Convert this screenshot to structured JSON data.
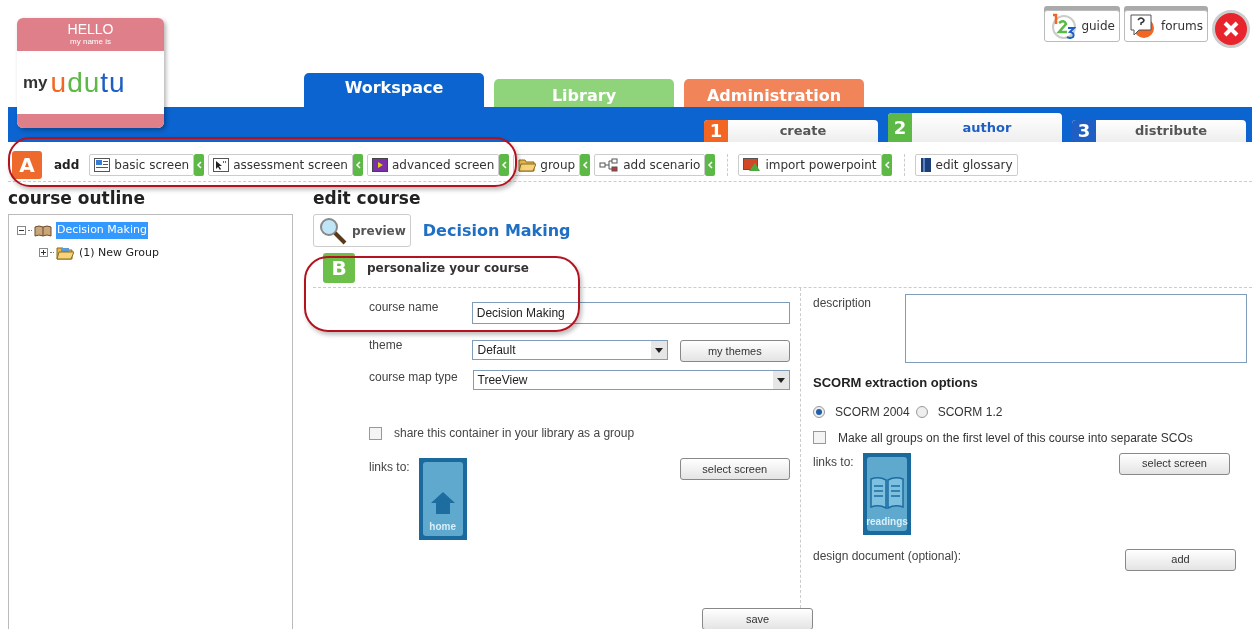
{
  "logo": {
    "badge_title": "HELLO",
    "badge_subtitle": "my name is",
    "prefix": "my",
    "name": "udutu"
  },
  "top_buttons": [
    {
      "kind": "guide",
      "label": "guide"
    },
    {
      "kind": "forums",
      "label": "forums"
    },
    {
      "kind": "close"
    }
  ],
  "main_tabs": [
    {
      "label": "Workspace",
      "selected": true,
      "color": "#0b64cf"
    },
    {
      "label": "Library",
      "selected": false,
      "color": "#8fd47a"
    },
    {
      "label": "Administration",
      "selected": false,
      "color": "#f2845a"
    }
  ],
  "step_tabs": [
    {
      "number": "1",
      "label": "create",
      "selected": false,
      "color": "#f26522"
    },
    {
      "number": "2",
      "label": "author",
      "selected": true,
      "color": "#5cb946"
    },
    {
      "number": "3",
      "label": "distribute",
      "selected": false,
      "color": "#1f5fc4"
    }
  ],
  "toolbar": {
    "badge": "A",
    "label": "add",
    "groups": [
      [
        {
          "label": "basic screen",
          "has_menu": true
        },
        {
          "label": "assessment screen",
          "has_menu": true
        },
        {
          "label": "advanced screen",
          "has_menu": true
        },
        {
          "label": "group",
          "has_menu": true
        },
        {
          "label": "add scenario",
          "has_menu": true
        }
      ],
      [
        {
          "label": "import powerpoint",
          "has_menu": true
        }
      ],
      [
        {
          "label": "edit glossary",
          "has_menu": false
        }
      ]
    ]
  },
  "outline": {
    "title": "course outline",
    "tree": [
      {
        "label": "Decision Making",
        "selected": true,
        "expanded": true,
        "children": [
          {
            "label": "(1) New Group",
            "selected": false,
            "expanded": false
          }
        ]
      }
    ]
  },
  "edit": {
    "title": "edit course",
    "preview_label": "preview",
    "course_title": "Decision Making",
    "section": {
      "badge": "B",
      "title": "personalize your course"
    },
    "course_name": {
      "label": "course name",
      "value": "Decision Making"
    },
    "theme": {
      "label": "theme",
      "value": "Default",
      "button": "my themes"
    },
    "map_type": {
      "label": "course map type",
      "value": "TreeView"
    },
    "share": {
      "label": "share this container in your library as a group",
      "checked": false
    },
    "links_left": {
      "label": "links to:",
      "tile_label": "home",
      "button": "select screen"
    },
    "description": {
      "label": "description"
    },
    "scorm": {
      "title": "SCORM extraction options",
      "options": [
        {
          "label": "SCORM 2004",
          "selected": true
        },
        {
          "label": "SCORM 1.2",
          "selected": false
        }
      ],
      "separate": {
        "label": "Make all groups on the first level of this course into separate SCOs",
        "checked": false
      }
    },
    "links_right": {
      "label": "links to:",
      "tile_label": "readings",
      "button": "select screen"
    },
    "design_document": {
      "label": "design document (optional):",
      "button": "add"
    },
    "save": "save"
  }
}
